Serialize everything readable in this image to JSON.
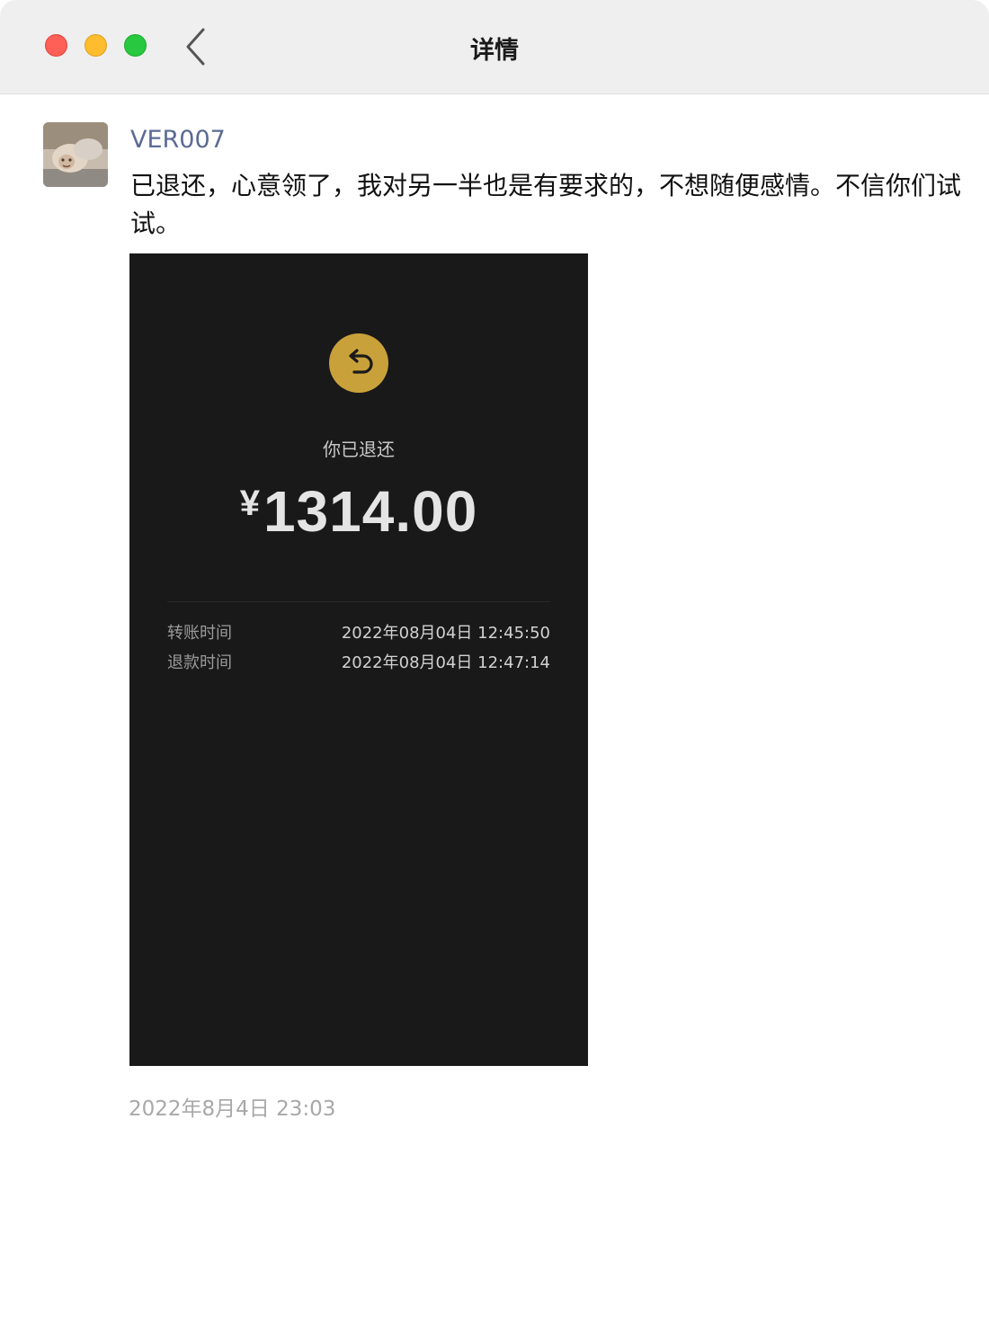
{
  "window": {
    "title": "详情",
    "controls": [
      "close",
      "minimize",
      "maximize"
    ]
  },
  "post": {
    "username": "VER007",
    "message": "已退还，心意领了，我对另一半也是有要求的，不想随便感情。不信你们试试。",
    "timestamp": "2022年8月4日 23:03",
    "attachment": {
      "status_label": "你已退还",
      "currency": "¥",
      "amount": "1314.00",
      "rows": [
        {
          "label": "转账时间",
          "value": "2022年08月04日 12:45:50"
        },
        {
          "label": "退款时间",
          "value": "2022年08月04日 12:47:14"
        }
      ],
      "accent_color": "#c9a13a",
      "background_color": "#191919"
    }
  },
  "icons": {
    "back": "chevron-left-icon",
    "refund": "return-arrow-icon"
  }
}
